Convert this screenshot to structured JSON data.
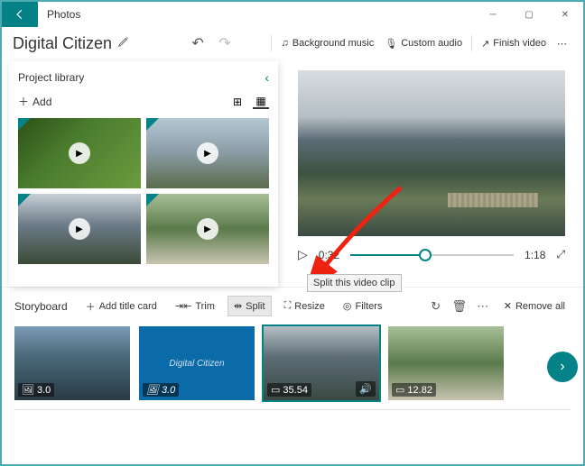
{
  "window": {
    "title": "Photos"
  },
  "header": {
    "project_name": "Digital Citizen",
    "bg_music": "Background music",
    "custom_audio": "Custom audio",
    "finish": "Finish video"
  },
  "library": {
    "title": "Project library",
    "add": "Add"
  },
  "player": {
    "current": "0:32",
    "total": "1:18"
  },
  "tooltip": "Split this video clip",
  "storyboard": {
    "title": "Storyboard",
    "add_title": "Add title card",
    "trim": "Trim",
    "split": "Split",
    "resize": "Resize",
    "filters": "Filters",
    "remove_all": "Remove all"
  },
  "clips": [
    {
      "duration": "3.0",
      "type": "image"
    },
    {
      "duration": "3.0",
      "type": "image",
      "title_text": "Digital Citizen"
    },
    {
      "duration": "35.54",
      "type": "video",
      "selected": true
    },
    {
      "duration": "12.82",
      "type": "video"
    }
  ]
}
